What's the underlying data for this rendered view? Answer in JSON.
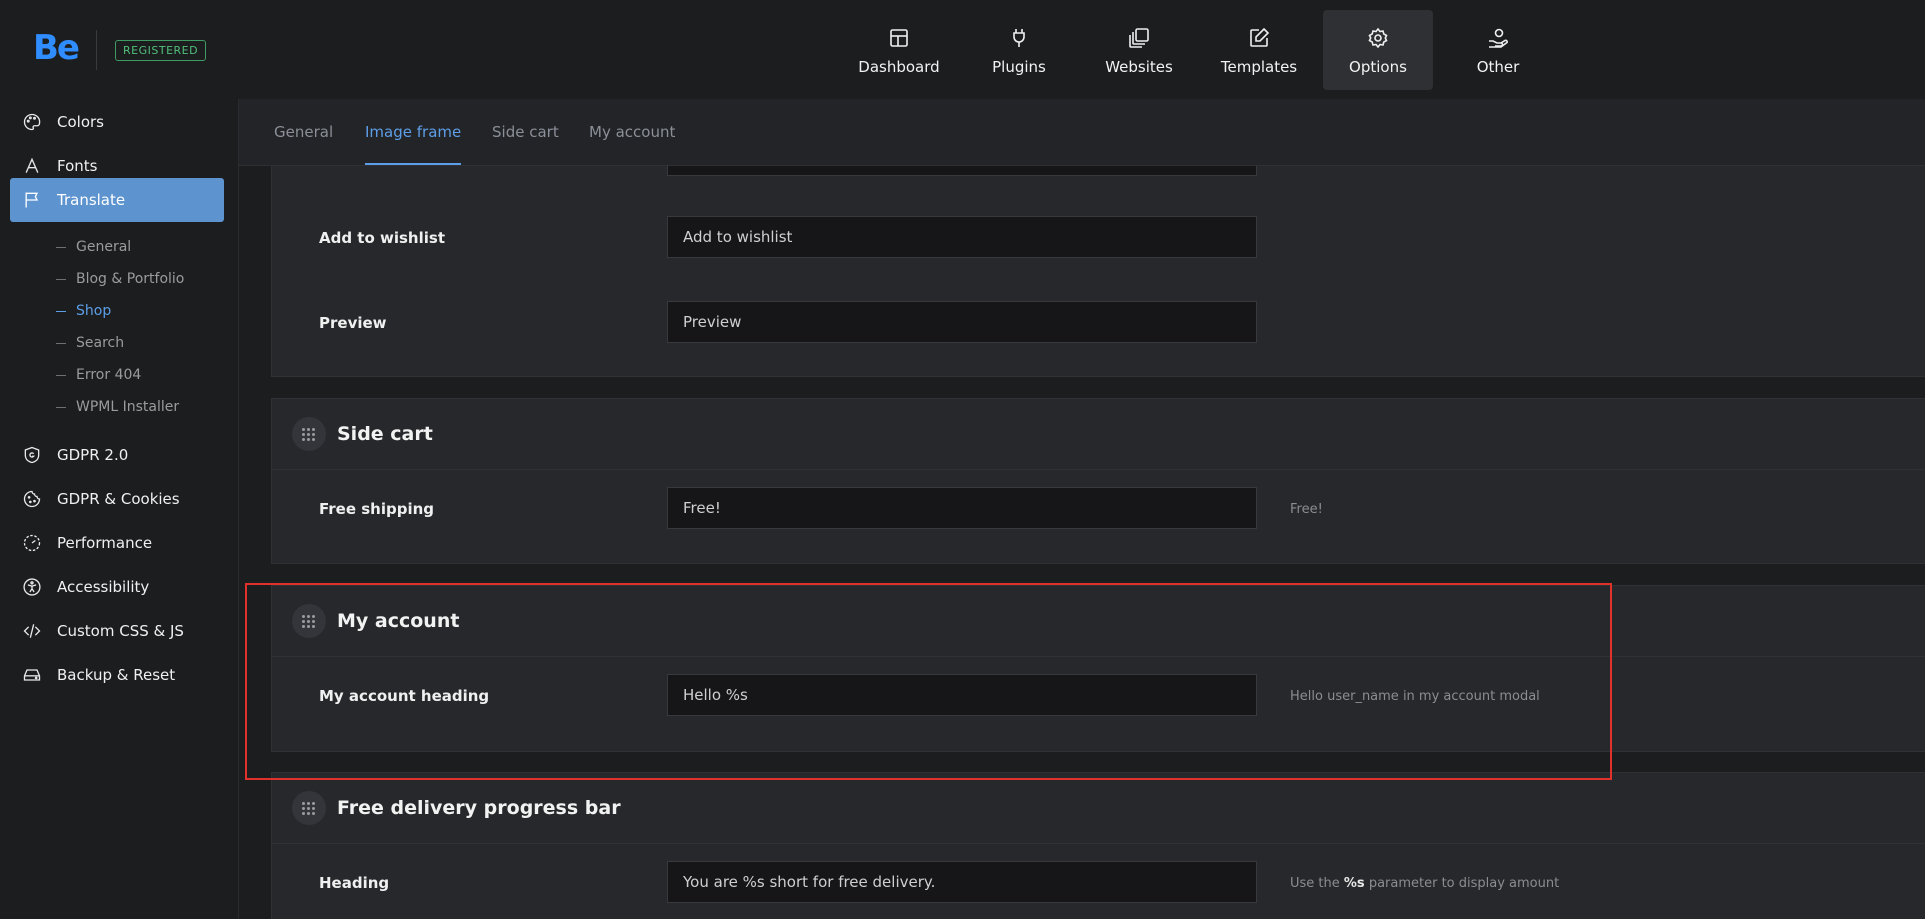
{
  "brand": {
    "logo": "Be",
    "badge": "REGISTERED"
  },
  "nav": [
    {
      "label": "Dashboard",
      "icon": "dashboard-icon"
    },
    {
      "label": "Plugins",
      "icon": "plug-icon"
    },
    {
      "label": "Websites",
      "icon": "websites-icon"
    },
    {
      "label": "Templates",
      "icon": "templates-icon"
    },
    {
      "label": "Options",
      "icon": "gear-icon",
      "active": true
    },
    {
      "label": "Other",
      "icon": "user-hand-icon"
    }
  ],
  "sidebar": {
    "items": [
      {
        "label": "Colors",
        "icon": "palette-icon"
      },
      {
        "label": "Fonts",
        "icon": "font-icon"
      },
      {
        "label": "Translate",
        "icon": "flag-icon",
        "active": true
      },
      {
        "label": "GDPR 2.0",
        "icon": "shield-icon"
      },
      {
        "label": "GDPR & Cookies",
        "icon": "cookie-icon"
      },
      {
        "label": "Performance",
        "icon": "gauge-icon"
      },
      {
        "label": "Accessibility",
        "icon": "accessibility-icon"
      },
      {
        "label": "Custom CSS & JS",
        "icon": "code-icon"
      },
      {
        "label": "Backup & Reset",
        "icon": "drive-icon"
      }
    ],
    "subitems": [
      {
        "label": "General"
      },
      {
        "label": "Blog & Portfolio"
      },
      {
        "label": "Shop",
        "active": true
      },
      {
        "label": "Search"
      },
      {
        "label": "Error 404"
      },
      {
        "label": "WPML Installer"
      }
    ]
  },
  "tabs": [
    {
      "label": "General"
    },
    {
      "label": "Image frame",
      "active": true
    },
    {
      "label": "Side cart"
    },
    {
      "label": "My account"
    }
  ],
  "panels": {
    "image_frame": {
      "fields": [
        {
          "label": "Add to wishlist",
          "value": "Add to wishlist"
        },
        {
          "label": "Preview",
          "value": "Preview"
        }
      ]
    },
    "side_cart": {
      "title": "Side cart",
      "fields": [
        {
          "label": "Free shipping",
          "value": "Free!",
          "hint": "Free!"
        }
      ]
    },
    "my_account": {
      "title": "My account",
      "fields": [
        {
          "label": "My account heading",
          "value": "Hello %s",
          "hint": "Hello user_name in my account modal"
        }
      ]
    },
    "free_delivery": {
      "title": "Free delivery progress bar",
      "fields": [
        {
          "label": "Heading",
          "value": "You are %s short for free delivery.",
          "hint_pre": "Use the",
          "hint_bold": "%s",
          "hint_post": "parameter to display amount"
        }
      ]
    }
  },
  "colors": {
    "accent": "#5d93cf",
    "highlight_border": "#e0322b",
    "badge": "#4fbf7a"
  }
}
